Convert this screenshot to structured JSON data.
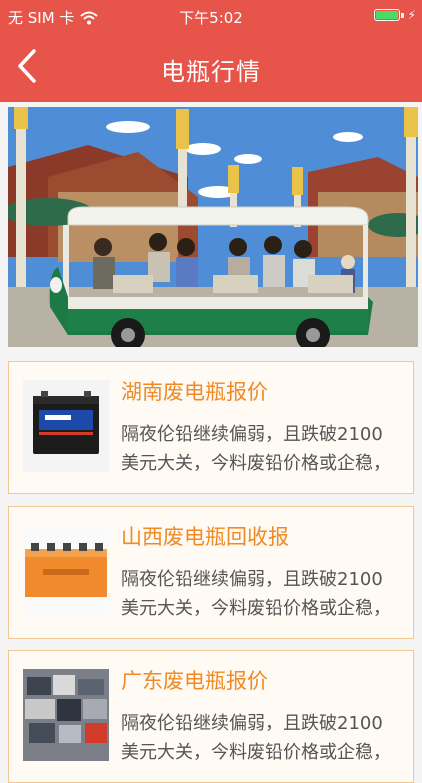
{
  "status_bar": {
    "carrier": "无 SIM 卡",
    "time": "下午5:02",
    "battery_color": "#4cd964"
  },
  "nav": {
    "title": "电瓶行情",
    "back_icon": "chevron-left-icon",
    "background": "#e6544a"
  },
  "news": [
    {
      "title": "湖南废电瓶报价",
      "line1": "隔夜伦铅继续偏弱，且跌破2100",
      "line2": "美元大关，今料废铅价格或企稳，"
    },
    {
      "title": "山西废电瓶回收报",
      "line1": "隔夜伦铅继续偏弱，且跌破2100",
      "line2": "美元大关，今料废铅价格或企稳，"
    },
    {
      "title": "广东废电瓶报价",
      "line1": "隔夜伦铅继续偏弱，且跌破2100",
      "line2": "美元大关，今料废铅价格或企稳，"
    }
  ],
  "colors": {
    "accent": "#e6544a",
    "title_orange": "#ef8a25",
    "card_border": "#f0c894"
  }
}
